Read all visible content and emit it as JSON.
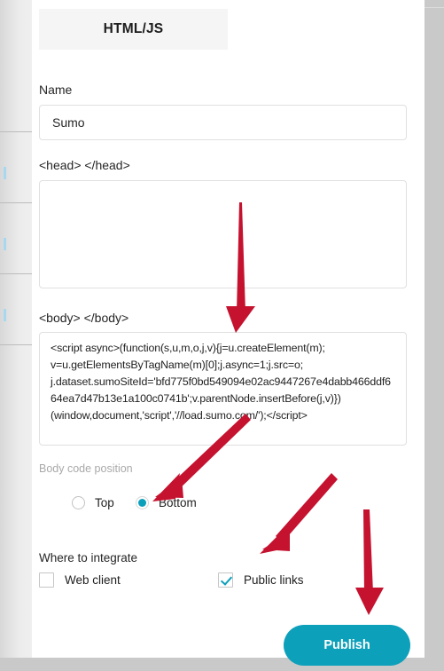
{
  "tab": {
    "label": "HTML/JS"
  },
  "fields": {
    "name_label": "Name",
    "name_value": "Sumo",
    "name_placeholder": "",
    "head_label": "<head> </head>",
    "head_value": "",
    "head_placeholder": "",
    "body_label": "<body> </body>",
    "body_value": "<script async>(function(s,u,m,o,j,v){j=u.createElement(m); v=u.getElementsByTagName(m)[0];j.async=1;j.src=o; j.dataset.sumoSiteId='bfd775f0bd549094e02ac9447267e4dabb466ddf664ea7d47b13e1a100c0741b';v.parentNode.insertBefore(j,v)}) (window,document,'script','//load.sumo.com/');</script>",
    "body_placeholder": ""
  },
  "body_position": {
    "label": "Body code position",
    "options": [
      {
        "label": "Top",
        "selected": false
      },
      {
        "label": "Bottom",
        "selected": true
      }
    ]
  },
  "integrate": {
    "label": "Where to integrate",
    "options": [
      {
        "label": "Web client",
        "checked": false
      },
      {
        "label": "Public links",
        "checked": true
      }
    ]
  },
  "actions": {
    "publish_label": "Publish"
  },
  "colors": {
    "accent_teal": "#0da0bb",
    "annotation_red": "#c4122f",
    "tab_background": "#f5f5f5",
    "input_border": "#e0e0e0",
    "muted_text": "#a9a9a9"
  },
  "annotations": {
    "arrows": [
      {
        "name": "arrow-to-body-field",
        "direction": "down"
      },
      {
        "name": "arrow-to-bottom-radio",
        "direction": "down-left"
      },
      {
        "name": "arrow-to-public-links-checkbox",
        "direction": "down-left"
      },
      {
        "name": "arrow-to-publish-button",
        "direction": "down"
      }
    ]
  }
}
